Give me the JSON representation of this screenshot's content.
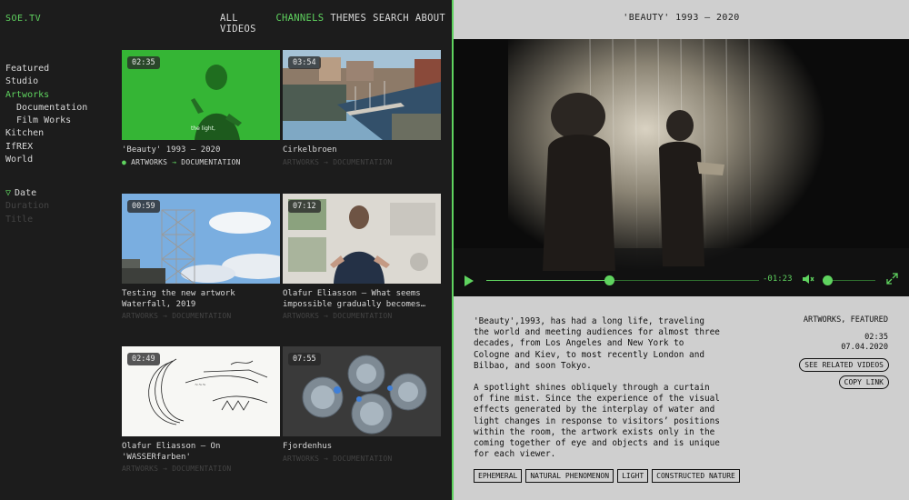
{
  "site": {
    "logo": "SOE.TV"
  },
  "top_nav": [
    {
      "label": "ALL VIDEOS",
      "active": false
    },
    {
      "label": "CHANNELS",
      "active": true
    },
    {
      "label": "THEMES",
      "active": false
    },
    {
      "label": "SEARCH",
      "active": false
    },
    {
      "label": "ABOUT",
      "active": false
    }
  ],
  "side_nav": [
    {
      "label": "Featured"
    },
    {
      "label": "Studio"
    },
    {
      "label": "Artworks"
    },
    {
      "label": "Documentation"
    },
    {
      "label": "Film Works"
    },
    {
      "label": "Kitchen"
    },
    {
      "label": "IfREX"
    },
    {
      "label": "World"
    }
  ],
  "sort": {
    "indicator": "▽",
    "options": [
      "Date",
      "Duration",
      "Title"
    ]
  },
  "videos": [
    {
      "duration": "02:35",
      "title": "'Beauty' 1993 – 2020",
      "tags_left": "ARTWORKS",
      "tags_arrow": "→",
      "tags_right": "DOCUMENTATION",
      "dot": "●",
      "thumb_caption": "the light,"
    },
    {
      "duration": "03:54",
      "title": "Cirkelbroen",
      "tags_left": "ARTWORKS",
      "tags_arrow": "→",
      "tags_right": "DOCUMENTATION"
    },
    {
      "duration": "00:59",
      "title": "Testing the new artwork Waterfall, 2019",
      "tags_left": "ARTWORKS",
      "tags_arrow": "→",
      "tags_right": "DOCUMENTATION"
    },
    {
      "duration": "07:12",
      "title": "Olafur Eliasson – What seems impossible gradually becomes…",
      "tags_left": "ARTWORKS",
      "tags_arrow": "→",
      "tags_right": "DOCUMENTATION"
    },
    {
      "duration": "02:49",
      "title": "Olafur Eliasson – On 'WASSERfarben'",
      "tags_left": "ARTWORKS",
      "tags_arrow": "→",
      "tags_right": "DOCUMENTATION"
    },
    {
      "duration": "07:55",
      "title": "Fjordenhus",
      "tags_left": "ARTWORKS",
      "tags_arrow": "→",
      "tags_right": "DOCUMENTATION"
    }
  ],
  "player": {
    "title": "'BEAUTY' 1993 – 2020",
    "time": "-01:23",
    "progress_fraction": 0.45,
    "volume_fraction": 0.05,
    "icons": {
      "play": "play-icon",
      "mute": "mute-icon",
      "fullscreen": "fullscreen-icon"
    }
  },
  "detail": {
    "paragraphs": [
      "'Beauty',1993, has had a long life, traveling the world and meeting audiences for almost three decades, from Los Angeles and New York to Cologne and Kiev, to most recently London and Bilbao, and soon Tokyo.",
      "A spotlight shines obliquely through a curtain of fine mist. Since the experience of the visual effects generated by the interplay of water and light changes in response to visitors’ positions within the room, the artwork exists only in the coming together of eye and objects and is unique for each viewer."
    ],
    "channels": "ARTWORKS, FEATURED",
    "duration": "02:35",
    "date": "07.04.2020",
    "related_label": "SEE RELATED VIDEOS",
    "copy_label": "COPY LINK",
    "themes": [
      "EPHEMERAL",
      "NATURAL PHENOMENON",
      "LIGHT",
      "CONSTRUCTED NATURE"
    ]
  },
  "colors": {
    "accent": "#5fd35f",
    "dark_bg": "#1c1c1c",
    "light_bg": "#cfcfcf"
  }
}
